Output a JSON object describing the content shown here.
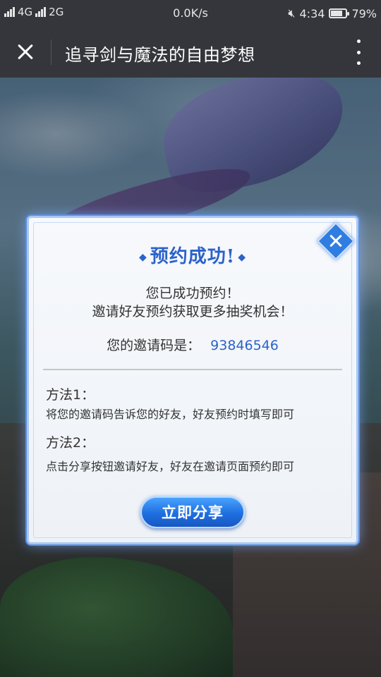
{
  "status_bar": {
    "signal_left": "4G",
    "network": "2G",
    "speed": "0.0K/s",
    "time": "4:34",
    "battery": "79%",
    "battery_level": 0.79
  },
  "nav": {
    "title": "追寻剑与魔法的自由梦想"
  },
  "modal": {
    "title": "预约成功!",
    "message_line1": "您已成功预约！",
    "message_line2": "邀请好友预约获取更多抽奖机会！",
    "invite_label": "您的邀请码是：",
    "invite_code": "93846546",
    "method1_label": "方法1：",
    "method1_desc": "将您的邀请码告诉您的好友，好友预约时填写即可",
    "method2_label": "方法2：",
    "method2_desc": "点击分享按钮邀请好友，好友在邀请页面预约即可",
    "share_button": "立即分享"
  },
  "colors": {
    "accent": "#2c63c9",
    "button": "#1f6fe0",
    "navbar": "#35363b"
  }
}
